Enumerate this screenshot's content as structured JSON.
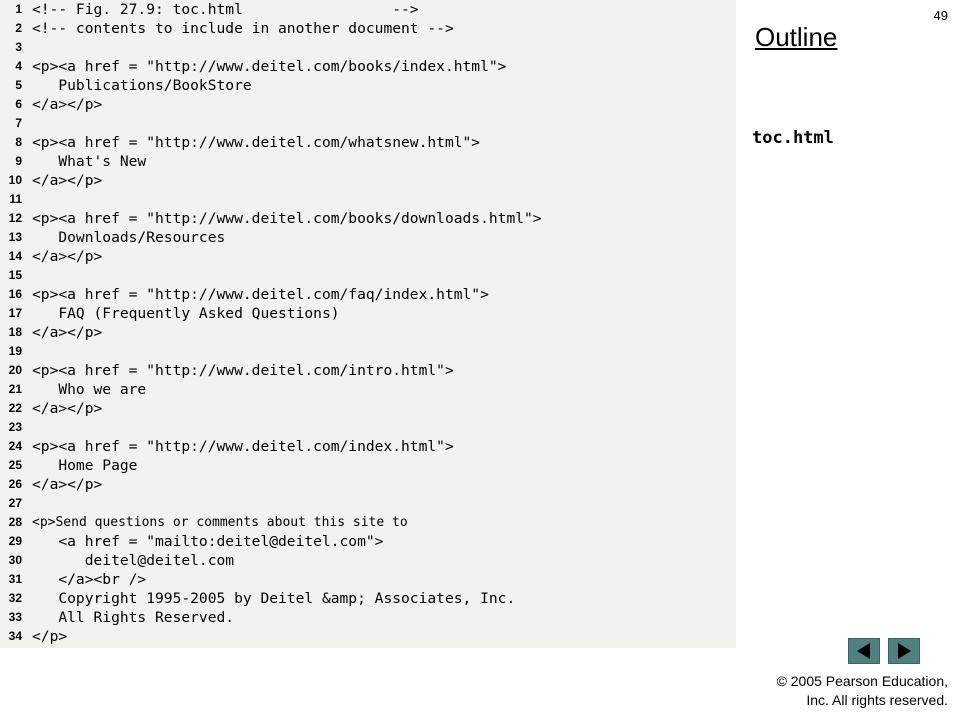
{
  "slide_number": "49",
  "sidebar": {
    "outline_title": "Outline",
    "file_label": "toc.html"
  },
  "navigation": {
    "prev_icon": "triangle-left-icon",
    "next_icon": "triangle-right-icon",
    "button_color": "#4f7f7f"
  },
  "footer": {
    "copyright_line1": "© 2005 Pearson Education,",
    "copyright_line2": "Inc.  All rights reserved."
  },
  "code": {
    "background_color": "#f2f2ef",
    "lines": [
      {
        "num": "1",
        "text": "<!-- Fig. 27.9: toc.html                 -->"
      },
      {
        "num": "2",
        "text": "<!-- contents to include in another document -->"
      },
      {
        "num": "3",
        "text": ""
      },
      {
        "num": "4",
        "text": "<p><a href = \"http://www.deitel.com/books/index.html\">"
      },
      {
        "num": "5",
        "text": "   Publications/BookStore"
      },
      {
        "num": "6",
        "text": "</a></p>"
      },
      {
        "num": "7",
        "text": ""
      },
      {
        "num": "8",
        "text": "<p><a href = \"http://www.deitel.com/whatsnew.html\">"
      },
      {
        "num": "9",
        "text": "   What's New"
      },
      {
        "num": "10",
        "text": "</a></p>"
      },
      {
        "num": "11",
        "text": ""
      },
      {
        "num": "12",
        "text": "<p><a href = \"http://www.deitel.com/books/downloads.html\">"
      },
      {
        "num": "13",
        "text": "   Downloads/Resources"
      },
      {
        "num": "14",
        "text": "</a></p>"
      },
      {
        "num": "15",
        "text": ""
      },
      {
        "num": "16",
        "text": "<p><a href = \"http://www.deitel.com/faq/index.html\">"
      },
      {
        "num": "17",
        "text": "   FAQ (Frequently Asked Questions)"
      },
      {
        "num": "18",
        "text": "</a></p>"
      },
      {
        "num": "19",
        "text": ""
      },
      {
        "num": "20",
        "text": "<p><a href = \"http://www.deitel.com/intro.html\">"
      },
      {
        "num": "21",
        "text": "   Who we are"
      },
      {
        "num": "22",
        "text": "</a></p>"
      },
      {
        "num": "23",
        "text": ""
      },
      {
        "num": "24",
        "text": "<p><a href = \"http://www.deitel.com/index.html\">"
      },
      {
        "num": "25",
        "text": "   Home Page"
      },
      {
        "num": "26",
        "text": "</a></p>"
      },
      {
        "num": "27",
        "text": ""
      },
      {
        "num": "28",
        "text": "<p>Send questions or comments about this site to"
      },
      {
        "num": "29",
        "text": "   <a href = \"mailto:deitel@deitel.com\">"
      },
      {
        "num": "30",
        "text": "      deitel@deitel.com"
      },
      {
        "num": "31",
        "text": "   </a><br />"
      },
      {
        "num": "32",
        "text": "   Copyright 1995-2005 by Deitel &amp; Associates, Inc."
      },
      {
        "num": "33",
        "text": "   All Rights Reserved."
      },
      {
        "num": "34",
        "text": "</p>"
      }
    ]
  }
}
